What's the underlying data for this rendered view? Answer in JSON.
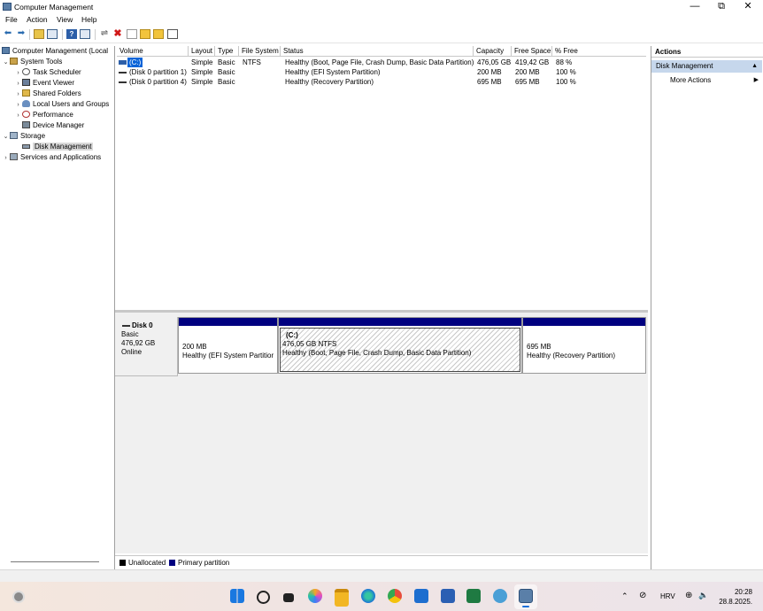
{
  "window": {
    "title": "Computer Management",
    "minimize_glyph": "—",
    "maximize_glyph": "⧉",
    "close_glyph": "✕"
  },
  "menu": [
    "File",
    "Action",
    "View",
    "Help"
  ],
  "toolbar_icons": [
    "back-icon",
    "forward-icon",
    "up-folder-icon",
    "show-hide-tree-icon",
    "help-icon",
    "console-icon",
    "connect-icon",
    "delete-icon",
    "properties-icon",
    "open-icon",
    "folder-icon",
    "window-icon"
  ],
  "tree": [
    {
      "label": "Computer Management (Local",
      "level": 0,
      "expander": "",
      "icon": "computer-icon"
    },
    {
      "label": "System Tools",
      "level": 0,
      "expander": "⌄",
      "icon": "tools-icon"
    },
    {
      "label": "Task Scheduler",
      "level": 1,
      "expander": "›",
      "icon": "clock-icon"
    },
    {
      "label": "Event Viewer",
      "level": 1,
      "expander": "›",
      "icon": "event-viewer-icon"
    },
    {
      "label": "Shared Folders",
      "level": 1,
      "expander": "›",
      "icon": "shared-folder-icon"
    },
    {
      "label": "Local Users and Groups",
      "level": 1,
      "expander": "›",
      "icon": "users-icon"
    },
    {
      "label": "Performance",
      "level": 1,
      "expander": "›",
      "icon": "performance-icon"
    },
    {
      "label": "Device Manager",
      "level": 1,
      "expander": "",
      "icon": "device-manager-icon"
    },
    {
      "label": "Storage",
      "level": 0,
      "expander": "⌄",
      "icon": "storage-icon"
    },
    {
      "label": "Disk Management",
      "level": 1,
      "expander": "",
      "icon": "disk-icon",
      "selected": true
    },
    {
      "label": "Services and Applications",
      "level": 0,
      "expander": "›",
      "icon": "services-icon"
    }
  ],
  "volume_table": {
    "columns": [
      "Volume",
      "Layout",
      "Type",
      "File System",
      "Status",
      "Capacity",
      "Free Space",
      "% Free"
    ],
    "rows": [
      [
        "(C:)",
        "Simple",
        "Basic",
        "NTFS",
        "Healthy (Boot, Page File, Crash Dump, Basic Data Partition)",
        "476,05 GB",
        "419,42 GB",
        "88 %"
      ],
      [
        "(Disk 0 partition 1)",
        "Simple",
        "Basic",
        "",
        "Healthy (EFI System Partition)",
        "200 MB",
        "200 MB",
        "100 %"
      ],
      [
        "(Disk 0 partition 4)",
        "Simple",
        "Basic",
        "",
        "Healthy (Recovery Partition)",
        "695 MB",
        "695 MB",
        "100 %"
      ]
    ]
  },
  "disk": {
    "name": "Disk 0",
    "type": "Basic",
    "size": "476,92 GB",
    "status": "Online",
    "partitions": [
      {
        "line1": "",
        "line2": "200 MB",
        "line3": "Healthy (EFI System Partitior"
      },
      {
        "line1": "(C:)",
        "line2": "476,05 GB NTFS",
        "line3": "Healthy (Boot, Page File, Crash Dump, Basic Data Partition)"
      },
      {
        "line1": "",
        "line2": "695 MB",
        "line3": "Healthy (Recovery Partition)"
      }
    ]
  },
  "legend": {
    "unallocated": "Unallocated",
    "primary": "Primary partition",
    "unallocated_color": "#000000",
    "primary_color": "#000080"
  },
  "actions": {
    "title": "Actions",
    "section": "Disk Management",
    "item": "More Actions"
  },
  "taskbar": {
    "time": "20:28",
    "date": "28.8.2025.",
    "lang": "HRV",
    "apps": [
      "start-icon",
      "search-icon",
      "task-view-icon",
      "copilot-icon",
      "file-explorer-icon",
      "edge-icon",
      "chrome-icon",
      "store-icon",
      "word-icon",
      "excel-icon",
      "snipping-icon",
      "computer-management-icon"
    ]
  }
}
